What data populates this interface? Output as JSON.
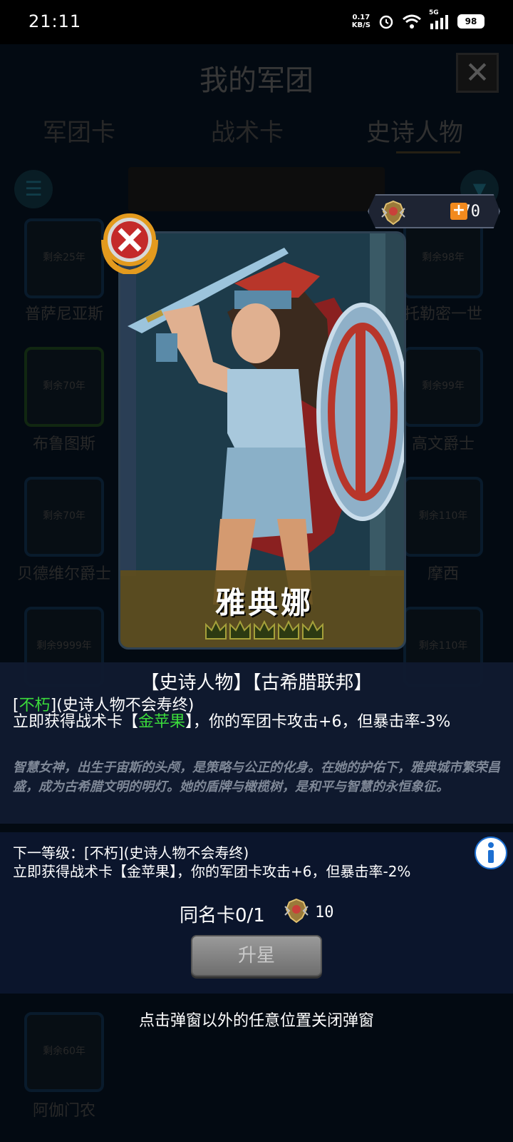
{
  "status_bar": {
    "time": "21:11",
    "speed_value": "0.17",
    "speed_unit": "KB/S",
    "network": "5G",
    "battery": "98"
  },
  "background": {
    "title": "我的军团",
    "tabs": [
      "军团卡",
      "战术卡",
      "史诗人物"
    ],
    "cards": [
      {
        "remaining": "剩余25年",
        "name": "普萨尼亚斯"
      },
      {
        "remaining": "剩余98年",
        "name": "托勒密一世"
      },
      {
        "remaining": "剩余70年",
        "name": "布鲁图斯"
      },
      {
        "remaining": "剩余99年",
        "name": "高文爵士"
      },
      {
        "remaining": "剩余70年",
        "name": "贝德维尔爵士"
      },
      {
        "remaining": "剩余110年",
        "name": "摩西"
      },
      {
        "remaining": "剩余9999年",
        "name": ""
      },
      {
        "remaining": "剩余110年",
        "name": ""
      },
      {
        "remaining": "剩余60年",
        "name": "阿伽门农"
      }
    ]
  },
  "currency": {
    "value": "70",
    "plus": "+"
  },
  "hero": {
    "name": "雅典娜",
    "stars": 5
  },
  "description": {
    "tags": "【史诗人物】【古希腊联邦】",
    "trait_open": "[",
    "trait_name": "不朽",
    "trait_close": "](史诗人物不会寿终)",
    "effect_pre": "立即获得战术卡【",
    "effect_card": "金苹果",
    "effect_post": "】，你的军团卡攻击+6，但暴击率-3%",
    "lore": "智慧女神，出生于宙斯的头颅，是策略与公正的化身。在她的护佑下，雅典城市繁荣昌盛，成为古希腊文明的明灯。她的盾牌与橄榄树，是和平与智慧的永恒象征。"
  },
  "next_level": {
    "level_text": "下一等级：[不朽](史诗人物不会寿终)",
    "effect_text": "立即获得战术卡【金苹果】，你的军团卡攻击+6，但暴击率-2%"
  },
  "upgrade": {
    "same_card_label": "同名卡0/1",
    "cost": "10",
    "button_label": "升星"
  },
  "hint": "点击弹窗以外的任意位置关闭弹窗"
}
